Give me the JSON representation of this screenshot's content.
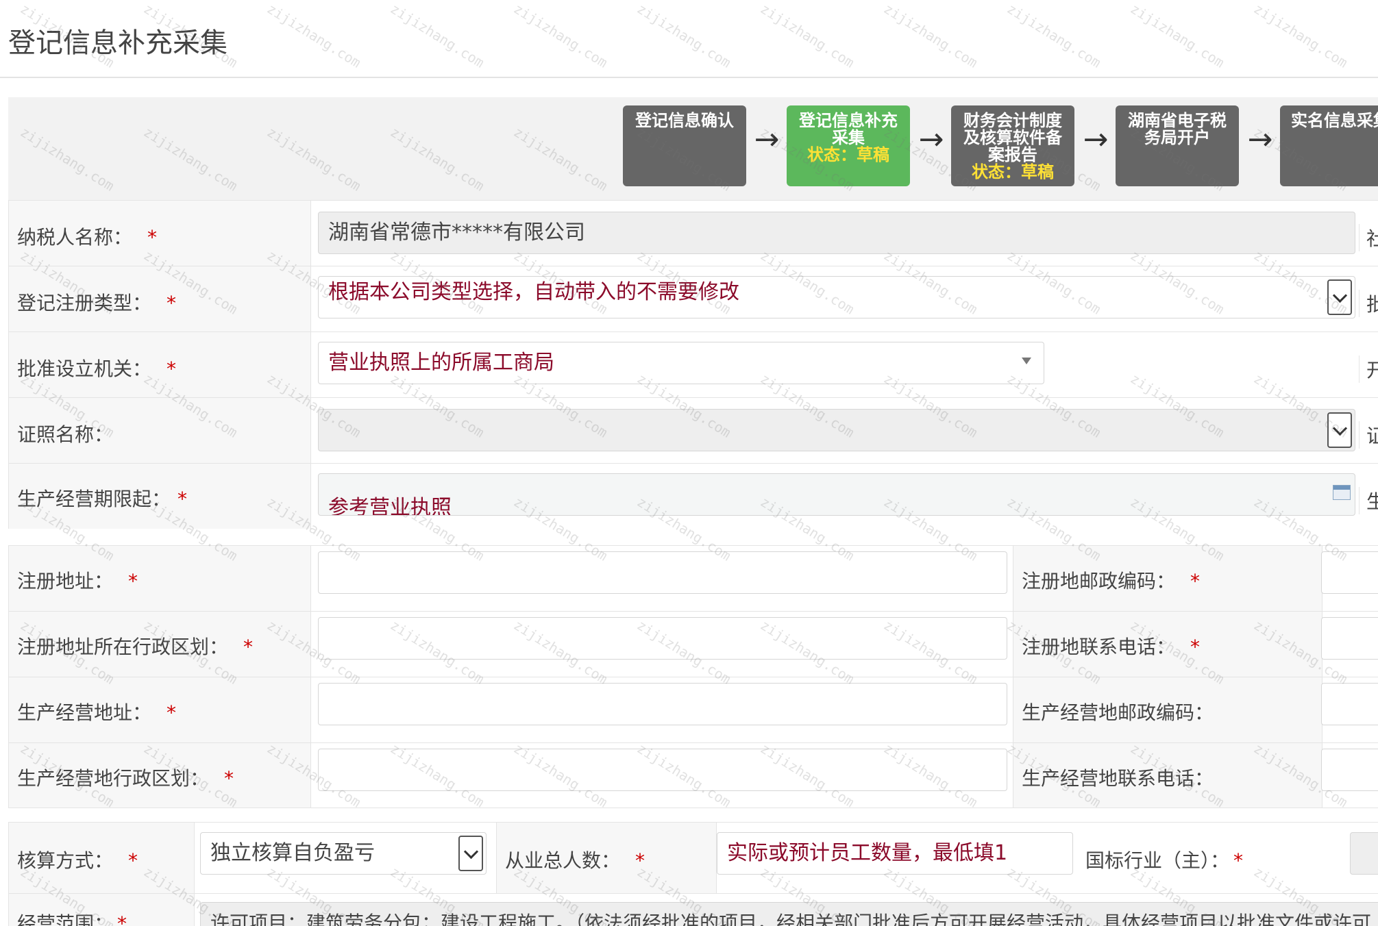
{
  "page": {
    "title": "登记信息补充采集"
  },
  "steps": [
    {
      "label": "登记信息确认",
      "status": ""
    },
    {
      "label": "登记信息补充采集",
      "status": "状态：草稿"
    },
    {
      "label": "财务会计制度及核算软件备案报告",
      "status": "状态：草稿"
    },
    {
      "label": "湖南省电子税务局开户",
      "status": ""
    },
    {
      "label": "实名信息采集",
      "status": ""
    }
  ],
  "arrow": "→",
  "form": {
    "taxpayer_name": {
      "label": "纳税人名称：",
      "required": "*",
      "value": "湖南省常德市*****有限公司",
      "side_label": "社"
    },
    "reg_type": {
      "label": "登记注册类型：",
      "required": "*",
      "hint": "根据本公司类型选择，自动带入的不需要修改",
      "side_label": "批"
    },
    "approval_org": {
      "label": "批准设立机关：",
      "required": "*",
      "hint": "营业执照上的所属工商局",
      "side_label": "开"
    },
    "license_name": {
      "label": "证照名称：",
      "side_label": "证"
    },
    "period_start": {
      "label": "生产经营期限起：",
      "required": "*",
      "hint": "参考营业执照",
      "side_label": "生"
    },
    "reg_address": {
      "label": "注册地址：",
      "required": "*",
      "right_label": "注册地邮政编码：",
      "right_required": "*"
    },
    "reg_region": {
      "label": "注册地址所在行政区划：",
      "required": "*",
      "right_label": "注册地联系电话：",
      "right_required": "*"
    },
    "biz_address": {
      "label": "生产经营地址：",
      "required": "*",
      "right_label": "生产经营地邮政编码："
    },
    "biz_region": {
      "label": "生产经营地行政区划：",
      "required": "*",
      "right_label": "生产经营地联系电话："
    },
    "accounting": {
      "label": "核算方式：",
      "required": "*",
      "value": "独立核算自负盈亏"
    },
    "employees": {
      "label": "从业总人数：",
      "required": "*",
      "hint": "实际或预计员工数量，最低填1"
    },
    "industry": {
      "label": "国标行业（主）：",
      "required": "*"
    },
    "scope": {
      "label": "经营范围：",
      "required": "*",
      "value": "许可项目：建筑劳务分包；建设工程施工。（依法须经批准的项目，经相关部门批准后方可开展经营活动，具体经营项目以批准文件或许可"
    }
  },
  "watermark": "zijizhang.com"
}
